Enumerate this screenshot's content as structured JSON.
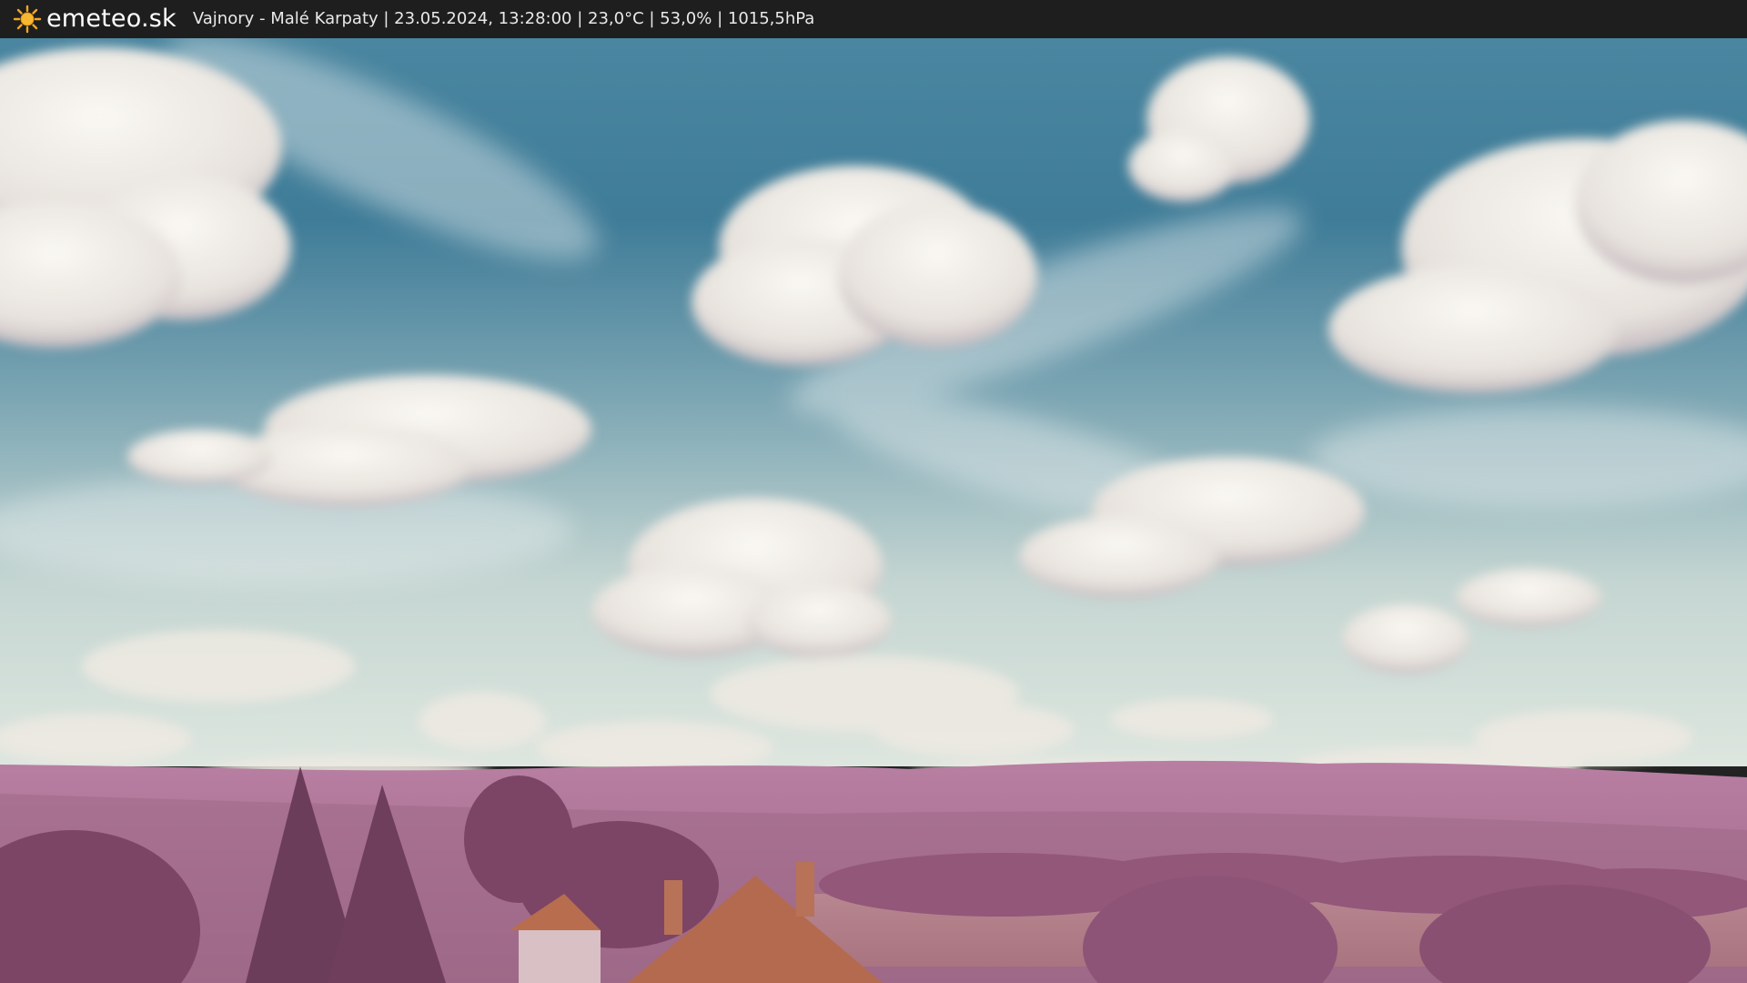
{
  "header": {
    "brand": "emeteo.sk",
    "logo_icon": "sun-icon",
    "caption": "Vajnory - Malé Karpaty | 23.05.2024, 13:28:00 | 23,0°C | 53,0% | 1015,5hPa"
  },
  "colors": {
    "bar": "#1e1e1e",
    "sun": "#f5a623",
    "sky_top": "#3f7c98",
    "sky_horizon": "#d7e2dc",
    "clouds": "#f2f0ea",
    "hills": "#b27a9c",
    "trees": "#8a4a6e",
    "roof": "#b86d4f"
  }
}
